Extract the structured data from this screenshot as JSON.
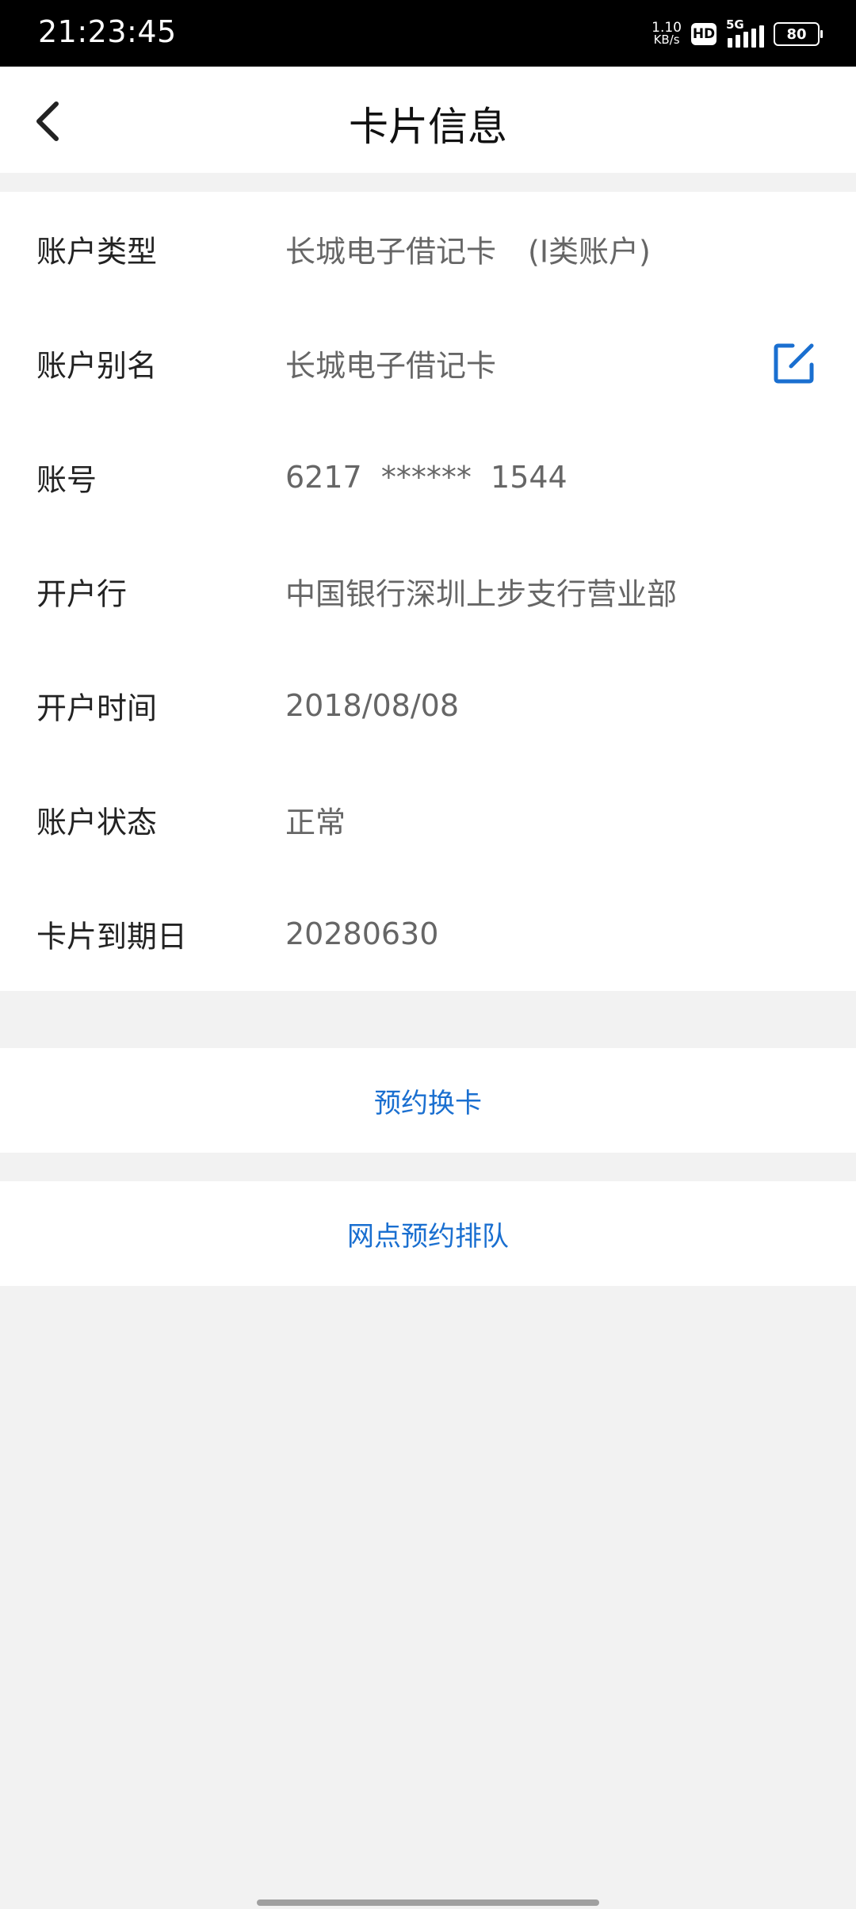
{
  "status_bar": {
    "time": "21:23:45",
    "net_speed_value": "1.10",
    "net_speed_unit": "KB/s",
    "hd_badge": "HD",
    "network_type": "5G",
    "battery_level": "80"
  },
  "nav": {
    "title": "卡片信息",
    "back_icon": "chevron-left-icon"
  },
  "info_rows": [
    {
      "label": "账户类型",
      "value": "长城电子借记卡",
      "sub_value": "(I类账户)"
    },
    {
      "label": "账户别名",
      "value": "长城电子借记卡",
      "edit_icon": "edit-square-icon"
    },
    {
      "label": "账号",
      "value": "6217  ******  1544"
    },
    {
      "label": "开户行",
      "value": "中国银行深圳上步支行营业部"
    },
    {
      "label": "开户时间",
      "value": "2018/08/08"
    },
    {
      "label": "账户状态",
      "value": "正常"
    },
    {
      "label": "卡片到期日",
      "value": "20280630"
    }
  ],
  "actions": {
    "reserve_card_replacement": "预约换卡",
    "branch_queue_reservation": "网点预约排队"
  },
  "colors": {
    "accent": "#1a6fd0",
    "background": "#f2f2f2",
    "label_text": "#222222",
    "value_text": "#666666"
  }
}
